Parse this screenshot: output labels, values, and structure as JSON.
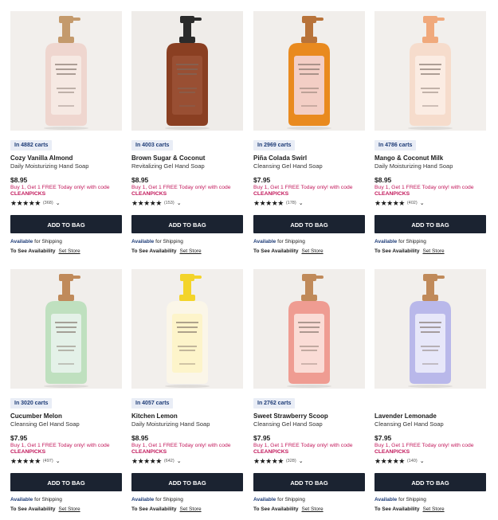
{
  "products": [
    {
      "carts": "In 4882 carts",
      "name": "Cozy Vanilla Almond",
      "sub": "Daily Moisturizing Hand Soap",
      "price": "$8.95",
      "promo_line1": "Buy 1, Get 1 FREE Today only! with code",
      "promo_code": "CLEANPICKS",
      "stars": "★★★★★",
      "reviews": "(368)",
      "button": "ADD TO BAG",
      "avail_label": "Available",
      "avail_text": "for Shipping",
      "store_label": "To See Availability",
      "store_link": "Set Store",
      "bottle": "#efd6cf",
      "pump": "#c49a6c",
      "label_color": "#f7ece6",
      "bg": "#f2efec"
    },
    {
      "carts": "In 4003 carts",
      "name": "Brown Sugar & Coconut",
      "sub": "Revitalizing Gel Hand Soap",
      "price": "$8.95",
      "promo_line1": "Buy 1, Get 1 FREE Today only! with code",
      "promo_code": "CLEANPICKS",
      "stars": "★★★★★",
      "reviews": "(153)",
      "button": "ADD TO BAG",
      "avail_label": "Available",
      "avail_text": "for Shipping",
      "store_label": "To See Availability",
      "store_link": "Set Store",
      "bottle": "#8a3f22",
      "pump": "#2b2b2b",
      "label_color": "#9b5236",
      "bg": "#efece9"
    },
    {
      "carts": "In 2969 carts",
      "name": "Piña Colada Swirl",
      "sub": "Cleansing Gel Hand Soap",
      "price": "$7.95",
      "promo_line1": "Buy 1, Get 1 FREE Today only! with code",
      "promo_code": "CLEANPICKS",
      "stars": "★★★★★",
      "reviews": "(178)",
      "button": "ADD TO BAG",
      "avail_label": "Available",
      "avail_text": "for Shipping",
      "store_label": "To See Availability",
      "store_link": "Set Store",
      "bottle": "#e98a1f",
      "pump": "#b8733a",
      "label_color": "#f5d9e3",
      "bg": "#f1eeeb"
    },
    {
      "carts": "In 4786 carts",
      "name": "Mango & Coconut Milk",
      "sub": "Daily Moisturizing Hand Soap",
      "price": "$8.95",
      "promo_line1": "Buy 1, Get 1 FREE Today only! with code",
      "promo_code": "CLEANPICKS",
      "stars": "★★★★★",
      "reviews": "(402)",
      "button": "ADD TO BAG",
      "avail_label": "Available",
      "avail_text": "for Shipping",
      "store_label": "To See Availability",
      "store_link": "Set Store",
      "bottle": "#f6dccc",
      "pump": "#f0a97c",
      "label_color": "#fbefe6",
      "bg": "#f2efec"
    },
    {
      "carts": "In 3020 carts",
      "name": "Cucumber Melon",
      "sub": "Cleansing Gel Hand Soap",
      "price": "$7.95",
      "promo_line1": "Buy 1, Get 1 FREE Today only! with code",
      "promo_code": "CLEANPICKS",
      "stars": "★★★★★",
      "reviews": "(497)",
      "button": "ADD TO BAG",
      "avail_label": "Available",
      "avail_text": "for Shipping",
      "store_label": "To See Availability",
      "store_link": "Set Store",
      "bottle": "#bfe0bf",
      "pump": "#c08a5a",
      "label_color": "#eaf3ee",
      "bg": "#f1eeeb"
    },
    {
      "carts": "In 4057 carts",
      "name": "Kitchen Lemon",
      "sub": "Daily Moisturizing Hand Soap",
      "price": "$8.95",
      "promo_line1": "Buy 1, Get 1 FREE Today only! with code",
      "promo_code": "CLEANPICKS",
      "stars": "★★★★★",
      "reviews": "(642)",
      "button": "ADD TO BAG",
      "avail_label": "Available",
      "avail_text": "for Shipping",
      "store_label": "To See Availability",
      "store_link": "Set Store",
      "bottle": "#fbf6e8",
      "pump": "#f3d42a",
      "label_color": "#fdf3c4",
      "bg": "#f2efec"
    },
    {
      "carts": "In 2762 carts",
      "name": "Sweet Strawberry Scoop",
      "sub": "Cleansing Gel Hand Soap",
      "price": "$7.95",
      "promo_line1": "Buy 1, Get 1 FREE Today only! with code",
      "promo_code": "CLEANPICKS",
      "stars": "★★★★★",
      "reviews": "(328)",
      "button": "ADD TO BAG",
      "avail_label": "Available",
      "avail_text": "for Shipping",
      "store_label": "To See Availability",
      "store_link": "Set Store",
      "bottle": "#ef9c92",
      "pump": "#c08a5a",
      "label_color": "#fbe7e2",
      "bg": "#f1eeeb"
    },
    {
      "carts": "",
      "name": "Lavender Lemonade",
      "sub": "Cleansing Gel Hand Soap",
      "price": "$7.95",
      "promo_line1": "Buy 1, Get 1 FREE Today only! with code",
      "promo_code": "CLEANPICKS",
      "stars": "★★★★★",
      "reviews": "(140)",
      "button": "ADD TO BAG",
      "avail_label": "Available",
      "avail_text": "for Shipping",
      "store_label": "To See Availability",
      "store_link": "Set Store",
      "bottle": "#b9b8ea",
      "pump": "#c08a5a",
      "label_color": "#efeefb",
      "bg": "#f2efec"
    }
  ]
}
